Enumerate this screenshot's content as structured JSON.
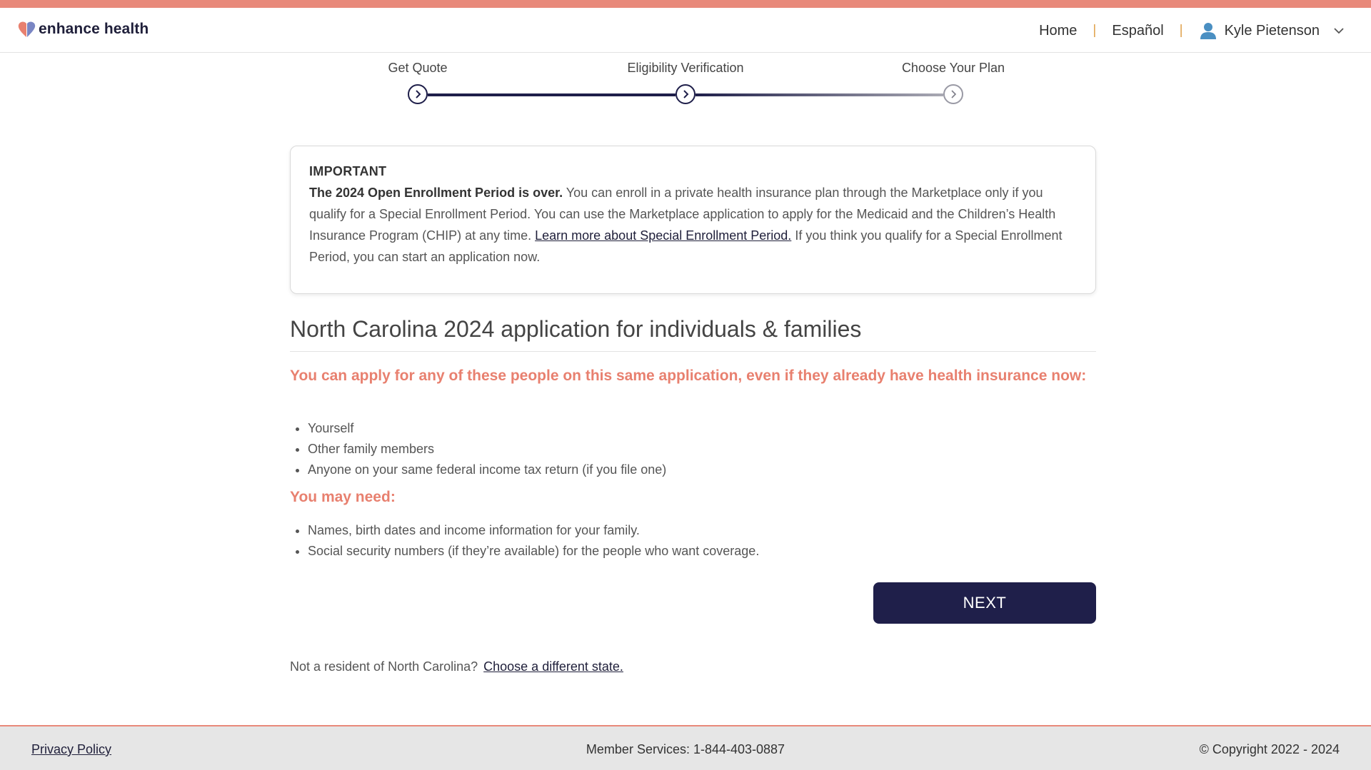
{
  "brand": {
    "name": "enhance health",
    "accent": "#e8897a",
    "navy": "#1f1f4a"
  },
  "nav": {
    "home": "Home",
    "language": "Español",
    "user_name": "Kyle Pietenson",
    "separator": "|"
  },
  "stepper": {
    "steps": [
      {
        "label": "Get Quote",
        "state": "complete"
      },
      {
        "label": "Eligibility Verification",
        "state": "current"
      },
      {
        "label": "Choose Your Plan",
        "state": "upcoming"
      }
    ]
  },
  "notice": {
    "heading": "IMPORTANT",
    "lead": "The 2024 Open Enrollment Period is over.",
    "body": " You can enroll in a private health insurance plan through the Marketplace only if you qualify for a Special Enrollment Period. You can use the Marketplace application to apply for the Medicaid and the Children’s Health Insurance Program (CHIP) at any time.  ",
    "link": "Learn more about Special Enrollment Period.",
    "tail": " If you think you qualify for a Special Enrollment Period, you can start an application now."
  },
  "main": {
    "title": "North Carolina 2024 application for individuals & families",
    "apply_heading": "You can apply for any of these people on this same application, even if they already have health insurance now:",
    "apply_items": [
      "Yourself",
      "Other family members",
      "Anyone on your same federal income tax return (if you file one)"
    ],
    "need_heading": "You may need:",
    "need_items": [
      "Names, birth dates and income information for your family.",
      "Social security numbers (if they’re available) for the people who want coverage."
    ],
    "next_label": "NEXT",
    "resident_text": "Not a resident of  North Carolina?",
    "resident_link": "Choose a different state."
  },
  "footer": {
    "privacy": "Privacy Policy",
    "member_services": "Member Services: 1-844-403-0887",
    "copyright": "© Copyright 2022 - 2024"
  }
}
